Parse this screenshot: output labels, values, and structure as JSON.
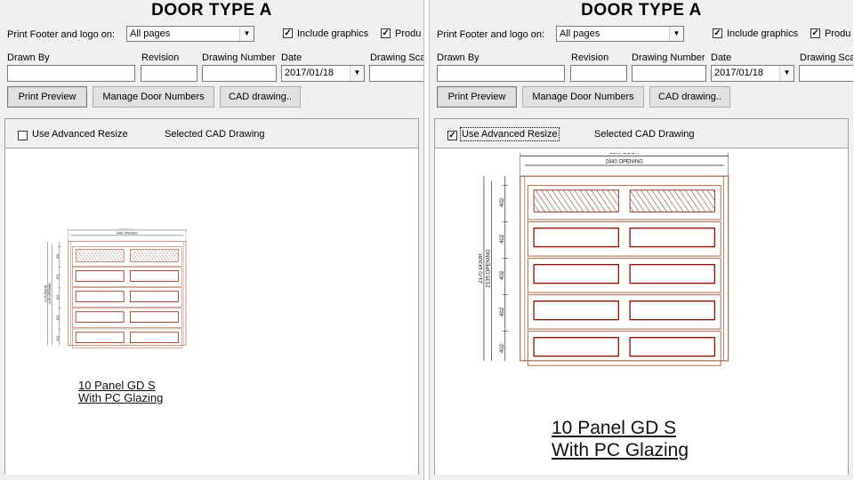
{
  "left_pane": {
    "title": "DOOR TYPE A",
    "print_footer_label": "Print Footer and logo on:",
    "print_footer_value": "All pages",
    "include_graphics_label": "Include graphics",
    "include_graphics_checked": true,
    "produ_label": "Produ",
    "produ_checked": true,
    "drawn_by_label": "Drawn By",
    "drawn_by_value": "",
    "revision_label": "Revision",
    "revision_value": "",
    "drawing_number_label": "Drawing Number",
    "drawing_number_value": "",
    "date_label": "Date",
    "date_value": "2017/01/18",
    "drawing_scale_label": "Drawing Sca",
    "drawing_scale_value": "",
    "print_preview_button": "Print Preview",
    "manage_door_numbers_button": "Manage Door Numbers",
    "cad_drawing_button": "CAD drawing..",
    "use_advanced_resize_label": "Use Advanced Resize",
    "use_advanced_resize_checked": false,
    "selected_cad_drawing_label": "Selected CAD Drawing",
    "drawing": {
      "dim_door_width": "2500 DOOR",
      "dim_opening_width": "2440 OPENING",
      "dim_door_height": "2170 DOOR",
      "dim_opening_height": "2135 OPENING",
      "panel_height": "402",
      "caption_line1": "10 Panel GD S",
      "caption_line2": "With PC Glazing"
    }
  },
  "right_pane": {
    "title": "DOOR TYPE A",
    "print_footer_label": "Print Footer and logo on:",
    "print_footer_value": "All pages",
    "include_graphics_label": "Include graphics",
    "include_graphics_checked": true,
    "produ_label": "Produ",
    "produ_checked": true,
    "drawn_by_label": "Drawn By",
    "drawn_by_value": "",
    "revision_label": "Revision",
    "revision_value": "",
    "drawing_number_label": "Drawing Number",
    "drawing_number_value": "",
    "date_label": "Date",
    "date_value": "2017/01/18",
    "drawing_scale_label": "Drawing Sca",
    "drawing_scale_value": "",
    "print_preview_button": "Print Preview",
    "manage_door_numbers_button": "Manage Door Numbers",
    "cad_drawing_button": "CAD drawing..",
    "use_advanced_resize_label": "Use Advanced Resize",
    "use_advanced_resize_checked": true,
    "selected_cad_drawing_label": "Selected CAD Drawing",
    "drawing": {
      "dim_door_width": "2500 DOOR",
      "dim_opening_width": "2440 OPENING",
      "dim_door_height": "2170 DOOR",
      "dim_opening_height": "2135 OPENING",
      "panel_height": "402",
      "caption_line1": "10 Panel GD S",
      "caption_line2": "With PC Glazing"
    }
  },
  "colors": {
    "panel_stroke": "#8b1a0a",
    "frame_stroke": "#a0522d",
    "dim_stroke": "#222222"
  }
}
